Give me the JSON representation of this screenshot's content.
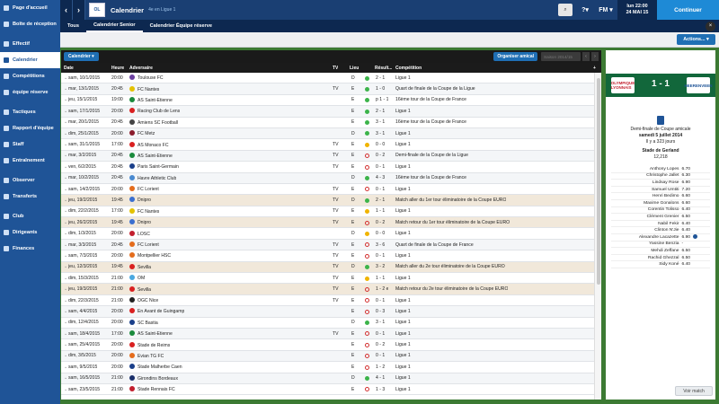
{
  "sidebar": {
    "items": [
      {
        "label": "Page d'accueil",
        "icon": "home-icon"
      },
      {
        "label": "Boîte de réception",
        "icon": "inbox-icon"
      },
      {
        "label": "Effectif",
        "icon": "squad-icon"
      },
      {
        "label": "Calendrier",
        "icon": "calendar-icon"
      },
      {
        "label": "Compétitions",
        "icon": "trophy-icon"
      },
      {
        "label": "équipe réserve",
        "icon": "reserve-icon"
      },
      {
        "label": "Tactiques",
        "icon": "tactics-icon"
      },
      {
        "label": "Rapport d'équipe",
        "icon": "report-icon"
      },
      {
        "label": "Staff",
        "icon": "staff-icon"
      },
      {
        "label": "Entraînement",
        "icon": "training-icon"
      },
      {
        "label": "Observer",
        "icon": "scouting-icon"
      },
      {
        "label": "Transferts",
        "icon": "transfers-icon"
      },
      {
        "label": "Club",
        "icon": "club-icon"
      },
      {
        "label": "Dirigeants",
        "icon": "board-icon"
      },
      {
        "label": "Finances",
        "icon": "finances-icon"
      }
    ],
    "active_index": 3
  },
  "topbar": {
    "back": "‹",
    "forward": "›",
    "crest": "OL",
    "title": "Calendrier",
    "subtitle": "4e en Ligue 1",
    "search_glyph": "⌕",
    "time": "lun 22:00",
    "date": "24 MAI 15",
    "continue": "Continuer",
    "fm": "FM ▾",
    "help": "?▾"
  },
  "tabs": [
    "Tous",
    "Calendrier Senior",
    "Calendrier Équipe réserve"
  ],
  "active_tab": 1,
  "actions": "Actions... ▾",
  "toolbar": {
    "calendar": "Calendrier ▾",
    "organize": "Organiser amical",
    "season": "Saison 2014/15"
  },
  "columns": {
    "date": "Date",
    "time": "Heure",
    "opponent": "Adversaire",
    "tv": "TV",
    "venue": "Lieu",
    "result": "Résult...",
    "competition": "Compétition"
  },
  "fixtures": [
    {
      "date": "sam, 10/1/2015",
      "time": "20:00",
      "opp": "Toulouse FC",
      "tv": "",
      "venue": "D",
      "res": "win",
      "score": "2 - 1",
      "comp": "Ligue 1",
      "euro": false,
      "color": "#6b3fa0"
    },
    {
      "date": "mar, 13/1/2015",
      "time": "20:45",
      "opp": "FC Nantes",
      "tv": "TV",
      "venue": "E",
      "res": "win",
      "score": "1 - 0",
      "comp": "Quart de finale de la Coupe de la Ligue",
      "euro": false,
      "color": "#e4c200"
    },
    {
      "date": "jeu, 15/1/2015",
      "time": "19:00",
      "opp": "AS Saint-Etienne",
      "tv": "",
      "venue": "E",
      "res": "win",
      "score": "p 1 - 1",
      "comp": "16ème tour de la Coupe de France",
      "euro": false,
      "color": "#1a8a3c"
    },
    {
      "date": "sam, 17/1/2015",
      "time": "20:00",
      "opp": "Racing Club de Lens",
      "tv": "",
      "venue": "E",
      "res": "win",
      "score": "2 - 1",
      "comp": "Ligue 1",
      "euro": false,
      "color": "#d92020"
    },
    {
      "date": "mar, 20/1/2015",
      "time": "20:45",
      "opp": "Amiens SC Football",
      "tv": "",
      "venue": "E",
      "res": "win",
      "score": "3 - 1",
      "comp": "16ème tour de la Coupe de France",
      "euro": false,
      "color": "#444444"
    },
    {
      "date": "dim, 25/1/2015",
      "time": "20:00",
      "opp": "FC Metz",
      "tv": "",
      "venue": "D",
      "res": "win",
      "score": "3 - 1",
      "comp": "Ligue 1",
      "euro": false,
      "color": "#8a1c2c"
    },
    {
      "date": "sam, 31/1/2015",
      "time": "17:00",
      "opp": "AS Monaco FC",
      "tv": "TV",
      "venue": "E",
      "res": "draw",
      "score": "0 - 0",
      "comp": "Ligue 1",
      "euro": false,
      "color": "#d92020"
    },
    {
      "date": "mar, 3/2/2015",
      "time": "20:45",
      "opp": "AS Saint-Etienne",
      "tv": "TV",
      "venue": "E",
      "res": "loss",
      "score": "0 - 2",
      "comp": "Demi-finale de la Coupe de la Ligue",
      "euro": false,
      "color": "#1a8a3c"
    },
    {
      "date": "ven, 6/2/2015",
      "time": "20:45",
      "opp": "Paris Saint-Germain",
      "tv": "TV",
      "venue": "E",
      "res": "loss",
      "score": "0 - 1",
      "comp": "Ligue 1",
      "euro": false,
      "color": "#1a3f8a"
    },
    {
      "date": "mar, 10/2/2015",
      "time": "20:45",
      "opp": "Havre Athletic Club",
      "tv": "",
      "venue": "D",
      "res": "win",
      "score": "4 - 3",
      "comp": "16ème tour de la Coupe de France",
      "euro": false,
      "color": "#4a8ad0"
    },
    {
      "date": "sam, 14/2/2015",
      "time": "20:00",
      "opp": "FC Lorient",
      "tv": "TV",
      "venue": "E",
      "res": "loss",
      "score": "0 - 1",
      "comp": "Ligue 1",
      "euro": false,
      "color": "#e46c1c"
    },
    {
      "date": "jeu, 19/2/2015",
      "time": "19:45",
      "opp": "Dnipro",
      "tv": "TV",
      "venue": "D",
      "res": "win",
      "score": "2 - 1",
      "comp": "Match aller du 1er tour éliminatoire de la Coupe EURO",
      "euro": true,
      "color": "#3a6fd0"
    },
    {
      "date": "dim, 22/2/2015",
      "time": "17:00",
      "opp": "FC Nantes",
      "tv": "TV",
      "venue": "E",
      "res": "draw",
      "score": "1 - 1",
      "comp": "Ligue 1",
      "euro": false,
      "color": "#e4c200"
    },
    {
      "date": "jeu, 26/2/2015",
      "time": "19:45",
      "opp": "Dnipro",
      "tv": "TV",
      "venue": "E",
      "res": "loss",
      "score": "0 - 2",
      "comp": "Match retour du 1er tour éliminatoire de la Coupe EURO",
      "euro": true,
      "color": "#3a6fd0"
    },
    {
      "date": "dim, 1/3/2015",
      "time": "20:00",
      "opp": "LOSC",
      "tv": "",
      "venue": "D",
      "res": "draw",
      "score": "0 - 0",
      "comp": "Ligue 1",
      "euro": false,
      "color": "#c21f2e"
    },
    {
      "date": "mar, 3/3/2015",
      "time": "20:45",
      "opp": "FC Lorient",
      "tv": "TV",
      "venue": "E",
      "res": "loss",
      "score": "3 - 6",
      "comp": "Quart de finale de la Coupe de France",
      "euro": false,
      "color": "#e46c1c"
    },
    {
      "date": "sam, 7/3/2015",
      "time": "20:00",
      "opp": "Montpellier HSC",
      "tv": "TV",
      "venue": "E",
      "res": "loss",
      "score": "0 - 1",
      "comp": "Ligue 1",
      "euro": false,
      "color": "#e46c1c"
    },
    {
      "date": "jeu, 12/3/2015",
      "time": "19:45",
      "opp": "Sevilla",
      "tv": "TV",
      "venue": "D",
      "res": "win",
      "score": "3 - 2",
      "comp": "Match aller du 2e tour éliminatoire de la Coupe EURO",
      "euro": true,
      "color": "#d92020"
    },
    {
      "date": "dim, 15/3/2015",
      "time": "21:00",
      "opp": "OM",
      "tv": "TV",
      "venue": "E",
      "res": "draw",
      "score": "1 - 1",
      "comp": "Ligue 1",
      "euro": false,
      "color": "#4aa8e0"
    },
    {
      "date": "jeu, 19/3/2015",
      "time": "21:00",
      "opp": "Sevilla",
      "tv": "TV",
      "venue": "E",
      "res": "loss",
      "score": "1 - 2 e",
      "comp": "Match retour du 2e tour éliminatoire de la Coupe EURO",
      "euro": true,
      "color": "#d92020"
    },
    {
      "date": "dim, 22/3/2015",
      "time": "21:00",
      "opp": "OGC Nice",
      "tv": "TV",
      "venue": "E",
      "res": "loss",
      "score": "0 - 1",
      "comp": "Ligue 1",
      "euro": false,
      "color": "#222222"
    },
    {
      "date": "sam, 4/4/2015",
      "time": "20:00",
      "opp": "En Avant de Guingamp",
      "tv": "",
      "venue": "E",
      "res": "loss",
      "score": "0 - 3",
      "comp": "Ligue 1",
      "euro": false,
      "color": "#d92020"
    },
    {
      "date": "dim, 12/4/2015",
      "time": "20:00",
      "opp": "SC Bastia",
      "tv": "",
      "venue": "D",
      "res": "win",
      "score": "3 - 1",
      "comp": "Ligue 1",
      "euro": false,
      "color": "#1a3f8a"
    },
    {
      "date": "sam, 18/4/2015",
      "time": "17:00",
      "opp": "AS Saint-Etienne",
      "tv": "TV",
      "venue": "E",
      "res": "loss",
      "score": "0 - 1",
      "comp": "Ligue 1",
      "euro": false,
      "color": "#1a8a3c"
    },
    {
      "date": "sam, 25/4/2015",
      "time": "20:00",
      "opp": "Stade de Reims",
      "tv": "",
      "venue": "E",
      "res": "loss",
      "score": "0 - 2",
      "comp": "Ligue 1",
      "euro": false,
      "color": "#d92020"
    },
    {
      "date": "dim, 3/5/2015",
      "time": "20:00",
      "opp": "Evian TG FC",
      "tv": "",
      "venue": "E",
      "res": "loss",
      "score": "0 - 1",
      "comp": "Ligue 1",
      "euro": false,
      "color": "#e46c1c"
    },
    {
      "date": "sam, 9/5/2015",
      "time": "20:00",
      "opp": "Stade Malherbe Caen",
      "tv": "",
      "venue": "E",
      "res": "loss",
      "score": "1 - 2",
      "comp": "Ligue 1",
      "euro": false,
      "color": "#1a3f8a"
    },
    {
      "date": "sam, 16/5/2015",
      "time": "21:00",
      "opp": "Girondins Bordeaux",
      "tv": "",
      "venue": "D",
      "res": "win",
      "score": "4 - 1",
      "comp": "Ligue 1",
      "euro": false,
      "color": "#1a2f6a"
    },
    {
      "date": "sam, 23/5/2015",
      "time": "21:00",
      "opp": "Stade Rennais FC",
      "tv": "",
      "venue": "E",
      "res": "loss",
      "score": "1 - 3",
      "comp": "Ligue 1",
      "euro": false,
      "color": "#c21f2e"
    }
  ],
  "match": {
    "home": "OLYMPIQUE LYONNAIS",
    "away": "HEERENVEEN",
    "score": "1 - 1",
    "competition": "Demi-finale de Coupe amicale",
    "date": "samedi 5 juillet 2014",
    "ago": "Il y a 323 jours",
    "stadium": "Stade de Gerland",
    "attendance": "12,218",
    "view": "Voir match",
    "players": [
      {
        "name": "Anthony Lopes",
        "rating": "6.70"
      },
      {
        "name": "Christophe Jallet",
        "rating": "6.30"
      },
      {
        "name": "Lindsay Rose",
        "rating": "6.90"
      },
      {
        "name": "Samuel Umtiti",
        "rating": "7.20"
      },
      {
        "name": "Henri Bedimo",
        "rating": "6.60"
      },
      {
        "name": "Maxime Gonalons",
        "rating": "6.60"
      },
      {
        "name": "Corentin Tolisso",
        "rating": "6.40"
      },
      {
        "name": "Clément Grenier",
        "rating": "6.50"
      },
      {
        "name": "Nabil Fekir",
        "rating": "6.40"
      },
      {
        "name": "Clinton N'Jie",
        "rating": "6.40"
      },
      {
        "name": "Alexandre Lacazette",
        "rating": "6.90",
        "mom": true
      },
      {
        "name": "Yassine Benzia",
        "rating": "-"
      },
      {
        "name": "Mehdi Zeffane",
        "rating": "6.50"
      },
      {
        "name": "Rachid Ghezzal",
        "rating": "6.50"
      },
      {
        "name": "Sidy Koné",
        "rating": "6.40"
      }
    ]
  }
}
